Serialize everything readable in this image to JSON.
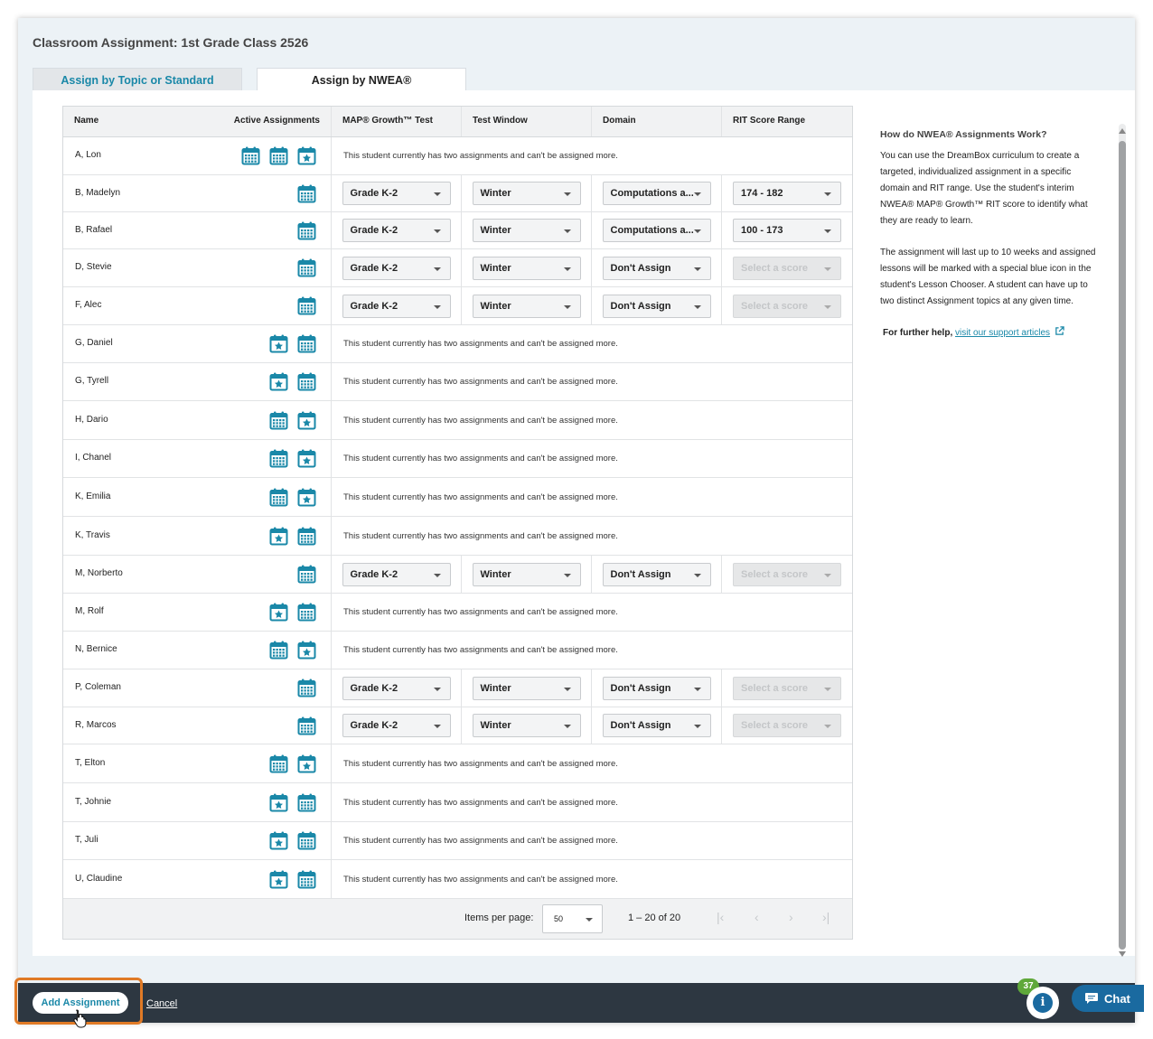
{
  "page_title": "Classroom Assignment: 1st Grade Class 2526",
  "tabs": [
    {
      "label": "Assign by Topic or Standard",
      "active": false
    },
    {
      "label": "Assign by NWEA®",
      "active": true
    }
  ],
  "table": {
    "headers": {
      "name": "Name",
      "active": "Active Assignments",
      "test": "MAP® Growth™ Test",
      "window": "Test Window",
      "domain": "Domain",
      "rit": "RIT Score Range"
    },
    "full_message": "This student currently has two assignments and can't be assigned more.",
    "rows": [
      {
        "name": "A, Lon",
        "icons": [
          "calendar-icon",
          "calendar-icon",
          "calendar-star-icon"
        ],
        "full": true
      },
      {
        "name": "B, Madelyn",
        "icons": [
          "calendar-icon"
        ],
        "full": false,
        "test": "Grade K-2",
        "window": "Winter",
        "domain": "Computations a...",
        "rit": "174 - 182",
        "rit_disabled": false
      },
      {
        "name": "B, Rafael",
        "icons": [
          "calendar-icon"
        ],
        "full": false,
        "test": "Grade K-2",
        "window": "Winter",
        "domain": "Computations a...",
        "rit": "100 - 173",
        "rit_disabled": false
      },
      {
        "name": "D, Stevie",
        "icons": [
          "calendar-icon"
        ],
        "full": false,
        "test": "Grade K-2",
        "window": "Winter",
        "domain": "Don't Assign",
        "rit": "Select a score",
        "rit_disabled": true
      },
      {
        "name": "F, Alec",
        "icons": [
          "calendar-icon"
        ],
        "full": false,
        "test": "Grade K-2",
        "window": "Winter",
        "domain": "Don't Assign",
        "rit": "Select a score",
        "rit_disabled": true
      },
      {
        "name": "G, Daniel",
        "icons": [
          "calendar-star-icon",
          "calendar-icon"
        ],
        "full": true
      },
      {
        "name": "G, Tyrell",
        "icons": [
          "calendar-star-icon",
          "calendar-icon"
        ],
        "full": true
      },
      {
        "name": "H, Dario",
        "icons": [
          "calendar-icon",
          "calendar-star-icon"
        ],
        "full": true
      },
      {
        "name": "I, Chanel",
        "icons": [
          "calendar-icon",
          "calendar-star-icon"
        ],
        "full": true
      },
      {
        "name": "K, Emilia",
        "icons": [
          "calendar-icon",
          "calendar-star-icon"
        ],
        "full": true
      },
      {
        "name": "K, Travis",
        "icons": [
          "calendar-star-icon",
          "calendar-icon"
        ],
        "full": true
      },
      {
        "name": "M, Norberto",
        "icons": [
          "calendar-icon"
        ],
        "full": false,
        "test": "Grade K-2",
        "window": "Winter",
        "domain": "Don't Assign",
        "rit": "Select a score",
        "rit_disabled": true
      },
      {
        "name": "M, Rolf",
        "icons": [
          "calendar-star-icon",
          "calendar-icon"
        ],
        "full": true
      },
      {
        "name": "N, Bernice",
        "icons": [
          "calendar-icon",
          "calendar-star-icon"
        ],
        "full": true
      },
      {
        "name": "P, Coleman",
        "icons": [
          "calendar-icon"
        ],
        "full": false,
        "test": "Grade K-2",
        "window": "Winter",
        "domain": "Don't Assign",
        "rit": "Select a score",
        "rit_disabled": true
      },
      {
        "name": "R, Marcos",
        "icons": [
          "calendar-icon"
        ],
        "full": false,
        "test": "Grade K-2",
        "window": "Winter",
        "domain": "Don't Assign",
        "rit": "Select a score",
        "rit_disabled": true
      },
      {
        "name": "T, Elton",
        "icons": [
          "calendar-icon",
          "calendar-star-icon"
        ],
        "full": true
      },
      {
        "name": "T, Johnie",
        "icons": [
          "calendar-star-icon",
          "calendar-icon"
        ],
        "full": true
      },
      {
        "name": "T, Juli",
        "icons": [
          "calendar-star-icon",
          "calendar-icon"
        ],
        "full": true
      },
      {
        "name": "U, Claudine",
        "icons": [
          "calendar-star-icon",
          "calendar-icon"
        ],
        "full": true
      }
    ]
  },
  "pagination": {
    "items_per_page_label": "Items per page:",
    "items_per_page": "50",
    "range": "1 – 20 of 20"
  },
  "help": {
    "title": "How do NWEA® Assignments Work?",
    "p1": "You can use the DreamBox curriculum to create a targeted, individualized assignment in a specific domain and RIT range. Use the student's interim NWEA® MAP® Growth™ RIT score to identify what they are ready to learn.",
    "p2": "The assignment will last up to 10 weeks and assigned lessons will be marked with a special blue icon in the student's Lesson Chooser. A student can have up to two distinct Assignment topics at any given time.",
    "more_prefix": "For further help,",
    "more_link": "visit our support articles"
  },
  "footer": {
    "add_label": "Add Assignment",
    "cancel_label": "Cancel",
    "badge_count": "37",
    "info_label": "i",
    "chat_label": "Chat"
  },
  "colors": {
    "accent": "#1a88a8",
    "icon": "#1a88a8",
    "bar": "#2d3741",
    "highlight": "#e07a26",
    "badge": "#5fa83a"
  }
}
